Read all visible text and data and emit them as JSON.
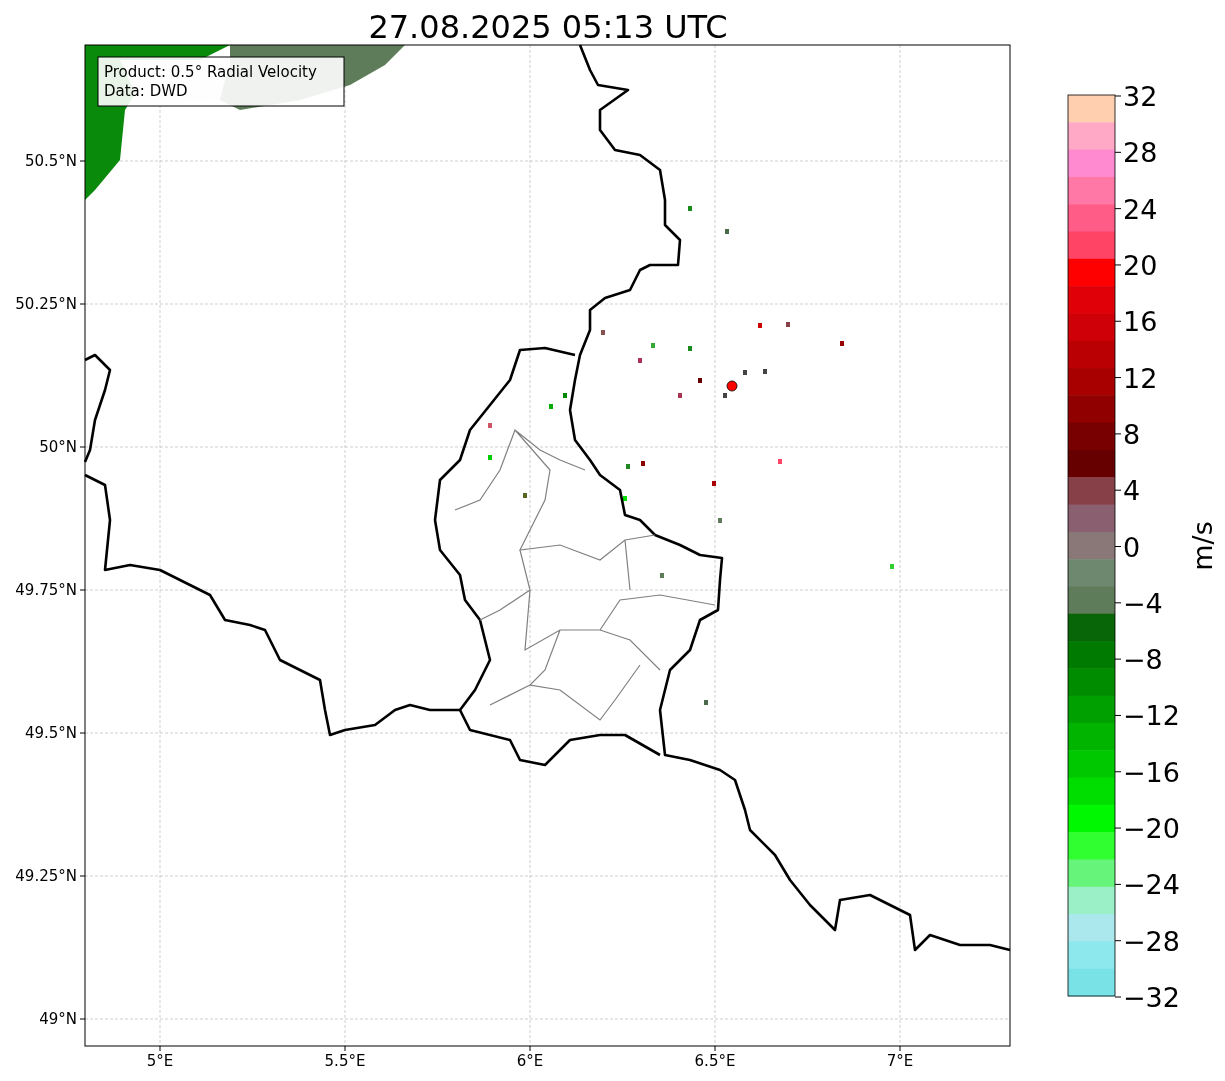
{
  "title": "27.08.2025 05:13 UTC",
  "info_box": [
    "Product: 0.5° Radial Velocity",
    "Data: DWD"
  ],
  "lat_ticks": [
    "50.5°N",
    "50.25°N",
    "50°N",
    "49.75°N",
    "49.5°N",
    "49.25°N",
    "49°N"
  ],
  "lon_ticks": [
    "5°E",
    "5.5°E",
    "6°E",
    "6.5°E",
    "7°E"
  ],
  "colorbar": {
    "label": "m/s",
    "ticks": [
      "32",
      "28",
      "24",
      "20",
      "16",
      "12",
      "8",
      "4",
      "0",
      "−4",
      "−8",
      "−12",
      "−16",
      "−20",
      "−24",
      "−28",
      "−32"
    ],
    "bands": [
      {
        "color": "#ffcfb0"
      },
      {
        "color": "#ffa9c6"
      },
      {
        "color": "#ff8ad0"
      },
      {
        "color": "#ff78a6"
      },
      {
        "color": "#ff5c88"
      },
      {
        "color": "#ff4466"
      },
      {
        "color": "#ff0000"
      },
      {
        "color": "#e00008"
      },
      {
        "color": "#d00008"
      },
      {
        "color": "#bb0004"
      },
      {
        "color": "#a80000"
      },
      {
        "color": "#900000"
      },
      {
        "color": "#780000"
      },
      {
        "color": "#660000"
      },
      {
        "color": "#884048"
      },
      {
        "color": "#8a6070"
      },
      {
        "color": "#8a7878"
      },
      {
        "color": "#6e8870"
      },
      {
        "color": "#5e7c5a"
      },
      {
        "color": "#086608"
      },
      {
        "color": "#007a00"
      },
      {
        "color": "#008c00"
      },
      {
        "color": "#00a000"
      },
      {
        "color": "#00b400"
      },
      {
        "color": "#00c800"
      },
      {
        "color": "#00de00"
      },
      {
        "color": "#00f800"
      },
      {
        "color": "#30ff30"
      },
      {
        "color": "#66f47a"
      },
      {
        "color": "#9cf0c8"
      },
      {
        "color": "#aae8ee"
      },
      {
        "color": "#8ce8ec"
      },
      {
        "color": "#78e2e6"
      }
    ]
  }
}
